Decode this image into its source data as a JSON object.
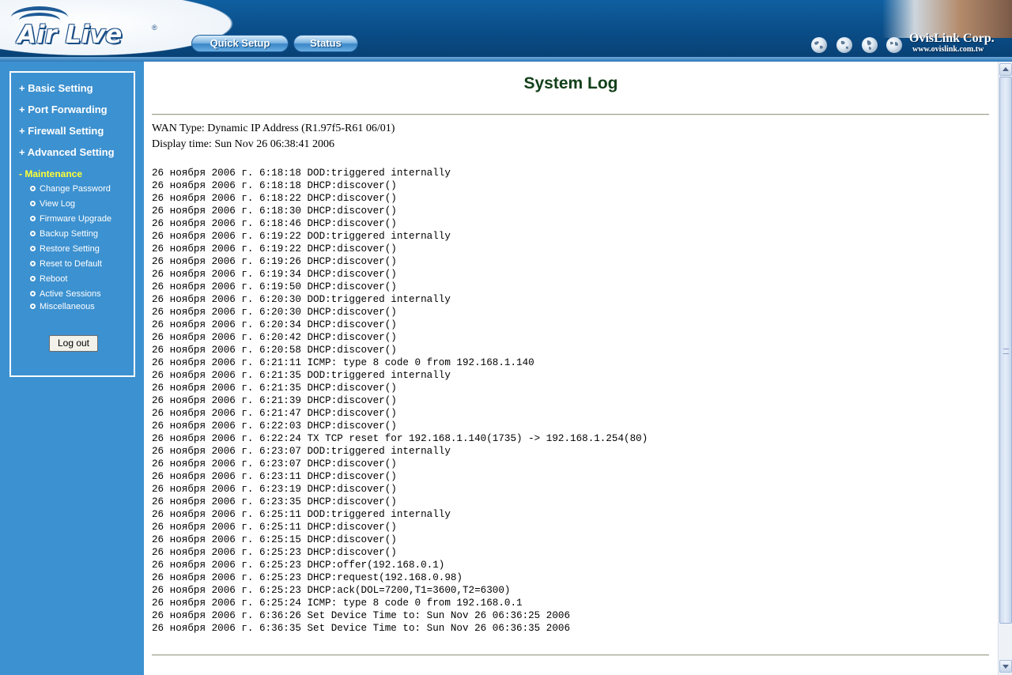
{
  "header": {
    "logo_text": "Air Live",
    "logo_mark": "®",
    "nav": [
      {
        "label": "Quick Setup"
      },
      {
        "label": "Status"
      }
    ],
    "brand_name": "OvisLink Corp.",
    "brand_url": "www.ovislink.com.tw"
  },
  "sidebar": {
    "menu": [
      {
        "label": "+ Basic Setting"
      },
      {
        "label": "+ Port Forwarding"
      },
      {
        "label": "+ Firewall Setting"
      },
      {
        "label": "+ Advanced Setting"
      },
      {
        "label": "- Maintenance"
      }
    ],
    "submenu": [
      {
        "label": "Change Password"
      },
      {
        "label": "View Log"
      },
      {
        "label": "Firmware Upgrade"
      },
      {
        "label": "Backup Setting"
      },
      {
        "label": "Restore Setting"
      },
      {
        "label": "Reset to Default"
      },
      {
        "label": "Reboot"
      },
      {
        "label": "Active Sessions"
      },
      {
        "label": "Miscellaneous"
      }
    ],
    "logout_label": "Log out"
  },
  "main": {
    "title": "System Log",
    "wan_type": "WAN Type: Dynamic IP Address (R1.97f5-R61 06/01)",
    "display_time": "Display time: Sun Nov 26 06:38:41 2006",
    "log_lines": [
      "26 ноября 2006 г. 6:18:18 DOD:triggered internally",
      "26 ноября 2006 г. 6:18:18 DHCP:discover()",
      "26 ноября 2006 г. 6:18:22 DHCP:discover()",
      "26 ноября 2006 г. 6:18:30 DHCP:discover()",
      "26 ноября 2006 г. 6:18:46 DHCP:discover()",
      "26 ноября 2006 г. 6:19:22 DOD:triggered internally",
      "26 ноября 2006 г. 6:19:22 DHCP:discover()",
      "26 ноября 2006 г. 6:19:26 DHCP:discover()",
      "26 ноября 2006 г. 6:19:34 DHCP:discover()",
      "26 ноября 2006 г. 6:19:50 DHCP:discover()",
      "26 ноября 2006 г. 6:20:30 DOD:triggered internally",
      "26 ноября 2006 г. 6:20:30 DHCP:discover()",
      "26 ноября 2006 г. 6:20:34 DHCP:discover()",
      "26 ноября 2006 г. 6:20:42 DHCP:discover()",
      "26 ноября 2006 г. 6:20:58 DHCP:discover()",
      "26 ноября 2006 г. 6:21:11 ICMP: type 8 code 0 from 192.168.1.140",
      "26 ноября 2006 г. 6:21:35 DOD:triggered internally",
      "26 ноября 2006 г. 6:21:35 DHCP:discover()",
      "26 ноября 2006 г. 6:21:39 DHCP:discover()",
      "26 ноября 2006 г. 6:21:47 DHCP:discover()",
      "26 ноября 2006 г. 6:22:03 DHCP:discover()",
      "26 ноября 2006 г. 6:22:24 TX TCP reset for 192.168.1.140(1735) -> 192.168.1.254(80)",
      "26 ноября 2006 г. 6:23:07 DOD:triggered internally",
      "26 ноября 2006 г. 6:23:07 DHCP:discover()",
      "26 ноября 2006 г. 6:23:11 DHCP:discover()",
      "26 ноября 2006 г. 6:23:19 DHCP:discover()",
      "26 ноября 2006 г. 6:23:35 DHCP:discover()",
      "26 ноября 2006 г. 6:25:11 DOD:triggered internally",
      "26 ноября 2006 г. 6:25:11 DHCP:discover()",
      "26 ноября 2006 г. 6:25:15 DHCP:discover()",
      "26 ноября 2006 г. 6:25:23 DHCP:discover()",
      "26 ноября 2006 г. 6:25:23 DHCP:offer(192.168.0.1)",
      "26 ноября 2006 г. 6:25:23 DHCP:request(192.168.0.98)",
      "26 ноября 2006 г. 6:25:23 DHCP:ack(DOL=7200,T1=3600,T2=6300)",
      "26 ноября 2006 г. 6:25:24 ICMP: type 8 code 0 from 192.168.0.1",
      "26 ноября 2006 г. 6:36:26 Set Device Time to: Sun Nov 26 06:36:25 2006",
      "26 ноября 2006 г. 6:36:35 Set Device Time to: Sun Nov 26 06:36:35 2006"
    ]
  },
  "colors": {
    "header_blue": "#0a4c86",
    "sidebar_blue": "#3c91d0",
    "active_menu": "#ffff33",
    "title_green": "#12401a"
  },
  "icons": [
    "globe-icon",
    "globe-icon",
    "globe-icon",
    "globe-icon",
    "dot-icon"
  ]
}
